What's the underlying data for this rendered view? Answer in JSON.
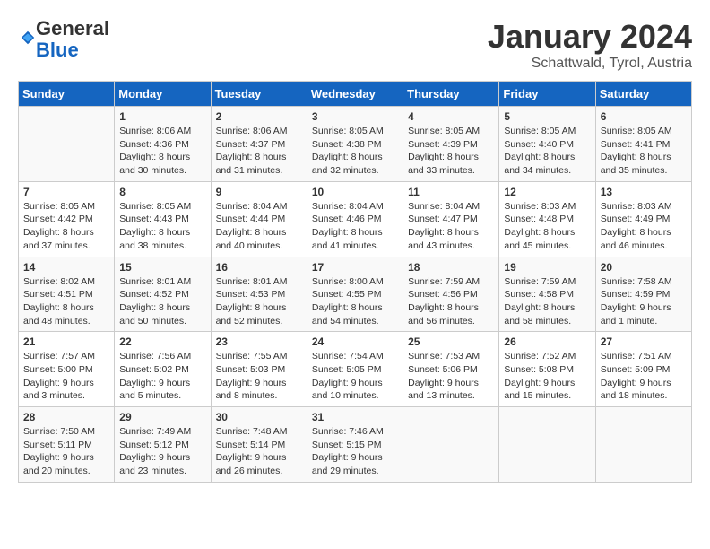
{
  "logo": {
    "general": "General",
    "blue": "Blue"
  },
  "title": "January 2024",
  "subtitle": "Schattwald, Tyrol, Austria",
  "headers": [
    "Sunday",
    "Monday",
    "Tuesday",
    "Wednesday",
    "Thursday",
    "Friday",
    "Saturday"
  ],
  "weeks": [
    [
      {
        "day": "",
        "sunrise": "",
        "sunset": "",
        "daylight": ""
      },
      {
        "day": "1",
        "sunrise": "Sunrise: 8:06 AM",
        "sunset": "Sunset: 4:36 PM",
        "daylight": "Daylight: 8 hours and 30 minutes."
      },
      {
        "day": "2",
        "sunrise": "Sunrise: 8:06 AM",
        "sunset": "Sunset: 4:37 PM",
        "daylight": "Daylight: 8 hours and 31 minutes."
      },
      {
        "day": "3",
        "sunrise": "Sunrise: 8:05 AM",
        "sunset": "Sunset: 4:38 PM",
        "daylight": "Daylight: 8 hours and 32 minutes."
      },
      {
        "day": "4",
        "sunrise": "Sunrise: 8:05 AM",
        "sunset": "Sunset: 4:39 PM",
        "daylight": "Daylight: 8 hours and 33 minutes."
      },
      {
        "day": "5",
        "sunrise": "Sunrise: 8:05 AM",
        "sunset": "Sunset: 4:40 PM",
        "daylight": "Daylight: 8 hours and 34 minutes."
      },
      {
        "day": "6",
        "sunrise": "Sunrise: 8:05 AM",
        "sunset": "Sunset: 4:41 PM",
        "daylight": "Daylight: 8 hours and 35 minutes."
      }
    ],
    [
      {
        "day": "7",
        "sunrise": "Sunrise: 8:05 AM",
        "sunset": "Sunset: 4:42 PM",
        "daylight": "Daylight: 8 hours and 37 minutes."
      },
      {
        "day": "8",
        "sunrise": "Sunrise: 8:05 AM",
        "sunset": "Sunset: 4:43 PM",
        "daylight": "Daylight: 8 hours and 38 minutes."
      },
      {
        "day": "9",
        "sunrise": "Sunrise: 8:04 AM",
        "sunset": "Sunset: 4:44 PM",
        "daylight": "Daylight: 8 hours and 40 minutes."
      },
      {
        "day": "10",
        "sunrise": "Sunrise: 8:04 AM",
        "sunset": "Sunset: 4:46 PM",
        "daylight": "Daylight: 8 hours and 41 minutes."
      },
      {
        "day": "11",
        "sunrise": "Sunrise: 8:04 AM",
        "sunset": "Sunset: 4:47 PM",
        "daylight": "Daylight: 8 hours and 43 minutes."
      },
      {
        "day": "12",
        "sunrise": "Sunrise: 8:03 AM",
        "sunset": "Sunset: 4:48 PM",
        "daylight": "Daylight: 8 hours and 45 minutes."
      },
      {
        "day": "13",
        "sunrise": "Sunrise: 8:03 AM",
        "sunset": "Sunset: 4:49 PM",
        "daylight": "Daylight: 8 hours and 46 minutes."
      }
    ],
    [
      {
        "day": "14",
        "sunrise": "Sunrise: 8:02 AM",
        "sunset": "Sunset: 4:51 PM",
        "daylight": "Daylight: 8 hours and 48 minutes."
      },
      {
        "day": "15",
        "sunrise": "Sunrise: 8:01 AM",
        "sunset": "Sunset: 4:52 PM",
        "daylight": "Daylight: 8 hours and 50 minutes."
      },
      {
        "day": "16",
        "sunrise": "Sunrise: 8:01 AM",
        "sunset": "Sunset: 4:53 PM",
        "daylight": "Daylight: 8 hours and 52 minutes."
      },
      {
        "day": "17",
        "sunrise": "Sunrise: 8:00 AM",
        "sunset": "Sunset: 4:55 PM",
        "daylight": "Daylight: 8 hours and 54 minutes."
      },
      {
        "day": "18",
        "sunrise": "Sunrise: 7:59 AM",
        "sunset": "Sunset: 4:56 PM",
        "daylight": "Daylight: 8 hours and 56 minutes."
      },
      {
        "day": "19",
        "sunrise": "Sunrise: 7:59 AM",
        "sunset": "Sunset: 4:58 PM",
        "daylight": "Daylight: 8 hours and 58 minutes."
      },
      {
        "day": "20",
        "sunrise": "Sunrise: 7:58 AM",
        "sunset": "Sunset: 4:59 PM",
        "daylight": "Daylight: 9 hours and 1 minute."
      }
    ],
    [
      {
        "day": "21",
        "sunrise": "Sunrise: 7:57 AM",
        "sunset": "Sunset: 5:00 PM",
        "daylight": "Daylight: 9 hours and 3 minutes."
      },
      {
        "day": "22",
        "sunrise": "Sunrise: 7:56 AM",
        "sunset": "Sunset: 5:02 PM",
        "daylight": "Daylight: 9 hours and 5 minutes."
      },
      {
        "day": "23",
        "sunrise": "Sunrise: 7:55 AM",
        "sunset": "Sunset: 5:03 PM",
        "daylight": "Daylight: 9 hours and 8 minutes."
      },
      {
        "day": "24",
        "sunrise": "Sunrise: 7:54 AM",
        "sunset": "Sunset: 5:05 PM",
        "daylight": "Daylight: 9 hours and 10 minutes."
      },
      {
        "day": "25",
        "sunrise": "Sunrise: 7:53 AM",
        "sunset": "Sunset: 5:06 PM",
        "daylight": "Daylight: 9 hours and 13 minutes."
      },
      {
        "day": "26",
        "sunrise": "Sunrise: 7:52 AM",
        "sunset": "Sunset: 5:08 PM",
        "daylight": "Daylight: 9 hours and 15 minutes."
      },
      {
        "day": "27",
        "sunrise": "Sunrise: 7:51 AM",
        "sunset": "Sunset: 5:09 PM",
        "daylight": "Daylight: 9 hours and 18 minutes."
      }
    ],
    [
      {
        "day": "28",
        "sunrise": "Sunrise: 7:50 AM",
        "sunset": "Sunset: 5:11 PM",
        "daylight": "Daylight: 9 hours and 20 minutes."
      },
      {
        "day": "29",
        "sunrise": "Sunrise: 7:49 AM",
        "sunset": "Sunset: 5:12 PM",
        "daylight": "Daylight: 9 hours and 23 minutes."
      },
      {
        "day": "30",
        "sunrise": "Sunrise: 7:48 AM",
        "sunset": "Sunset: 5:14 PM",
        "daylight": "Daylight: 9 hours and 26 minutes."
      },
      {
        "day": "31",
        "sunrise": "Sunrise: 7:46 AM",
        "sunset": "Sunset: 5:15 PM",
        "daylight": "Daylight: 9 hours and 29 minutes."
      },
      {
        "day": "",
        "sunrise": "",
        "sunset": "",
        "daylight": ""
      },
      {
        "day": "",
        "sunrise": "",
        "sunset": "",
        "daylight": ""
      },
      {
        "day": "",
        "sunrise": "",
        "sunset": "",
        "daylight": ""
      }
    ]
  ]
}
